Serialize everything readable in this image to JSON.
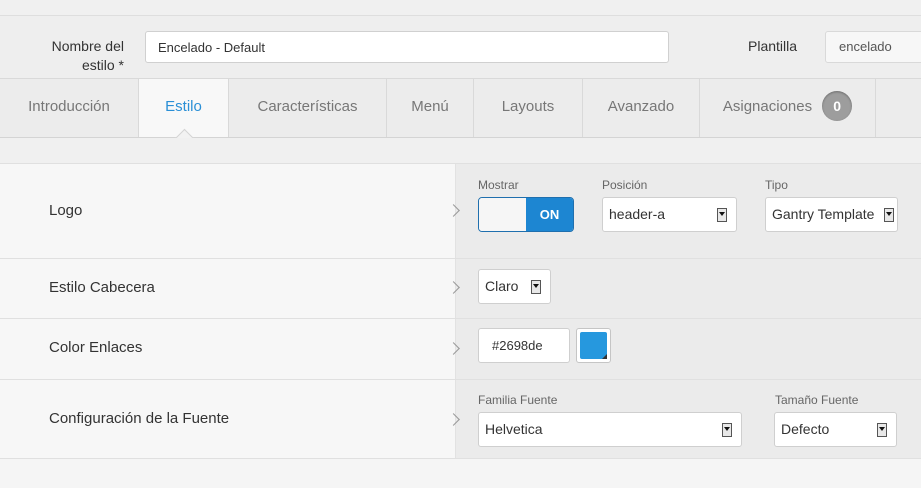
{
  "header": {
    "style_name_label": "Nombre del estilo *",
    "style_name_value": "Encelado - Default",
    "template_label": "Plantilla",
    "template_value": "encelado"
  },
  "tabs": [
    {
      "label": "Introducción",
      "active": false
    },
    {
      "label": "Estilo",
      "active": true
    },
    {
      "label": "Características",
      "active": false
    },
    {
      "label": "Menú",
      "active": false
    },
    {
      "label": "Layouts",
      "active": false
    },
    {
      "label": "Avanzado",
      "active": false
    },
    {
      "label": "Asignaciones",
      "active": false,
      "badge": "0"
    }
  ],
  "settings": {
    "logo": {
      "label": "Logo",
      "show_label": "Mostrar",
      "show_value": "ON",
      "position_label": "Posición",
      "position_value": "header-a",
      "type_label": "Tipo",
      "type_value": "Gantry Template"
    },
    "header_style": {
      "label": "Estilo Cabecera",
      "value": "Claro"
    },
    "link_color": {
      "label": "Color Enlaces",
      "value": "#2698de",
      "swatch_color": "#2698de"
    },
    "font": {
      "label": "Configuración de la Fuente",
      "family_label": "Familia Fuente",
      "family_value": "Helvetica",
      "size_label": "Tamaño Fuente",
      "size_value": "Defecto"
    }
  },
  "colors": {
    "accent": "#2a8fd6",
    "toggle_on": "#1d86d2",
    "badge": "#9d9d9d"
  },
  "icons": [
    "chevron-right-icon",
    "select-arrow-icon",
    "color-picker-corner-icon"
  ]
}
